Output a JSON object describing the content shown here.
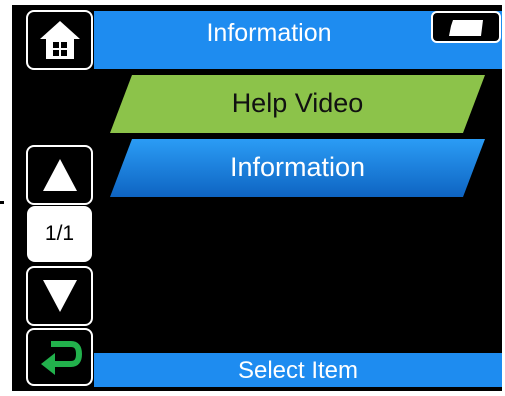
{
  "header": {
    "title": "Information",
    "home_icon": "home-icon",
    "sd_icon": "sd-card-icon"
  },
  "menu": {
    "items": [
      {
        "label": "Help Video",
        "color": "#8cc34a"
      },
      {
        "label": "Information",
        "color": "#1e8cf0"
      }
    ]
  },
  "pager": {
    "page": "1/1",
    "up_icon": "arrow-up-icon",
    "down_icon": "arrow-down-icon"
  },
  "footer": {
    "status": "Select Item",
    "back_icon": "return-arrow-icon"
  },
  "colors": {
    "accent": "#1e8cf0",
    "background": "#000000",
    "help_item": "#8cc34a",
    "back_arrow": "#22b14c"
  }
}
